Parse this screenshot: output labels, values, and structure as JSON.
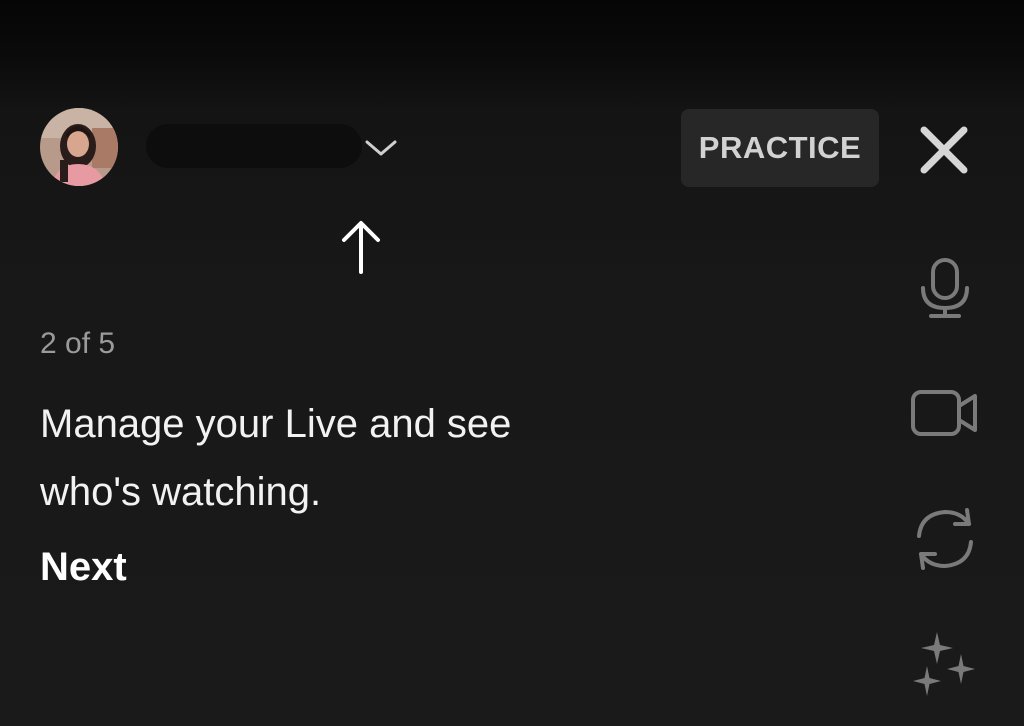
{
  "header": {
    "avatar_icon": "profile-avatar",
    "account_name": "",
    "chevron_icon": "chevron-down-icon",
    "practice_label": "PRACTICE",
    "close_icon": "close-icon"
  },
  "tooltip": {
    "pointer_icon": "arrow-up-icon",
    "step_counter": "2 of 5",
    "current_step": 2,
    "total_steps": 5,
    "message": "Manage your Live and see who's watching.",
    "next_label": "Next"
  },
  "side_controls": [
    {
      "name": "microphone",
      "icon": "microphone-icon"
    },
    {
      "name": "camera",
      "icon": "video-camera-icon"
    },
    {
      "name": "flip-camera",
      "icon": "flip-camera-icon"
    },
    {
      "name": "effects",
      "icon": "sparkles-icon"
    }
  ],
  "colors": {
    "background": "#161616",
    "practice_button_bg": "#272727",
    "practice_text": "#d2d2d2",
    "icon_dim": "#7a7a7a",
    "text_primary": "#f2f2f2",
    "text_secondary": "#9b9b9b"
  }
}
